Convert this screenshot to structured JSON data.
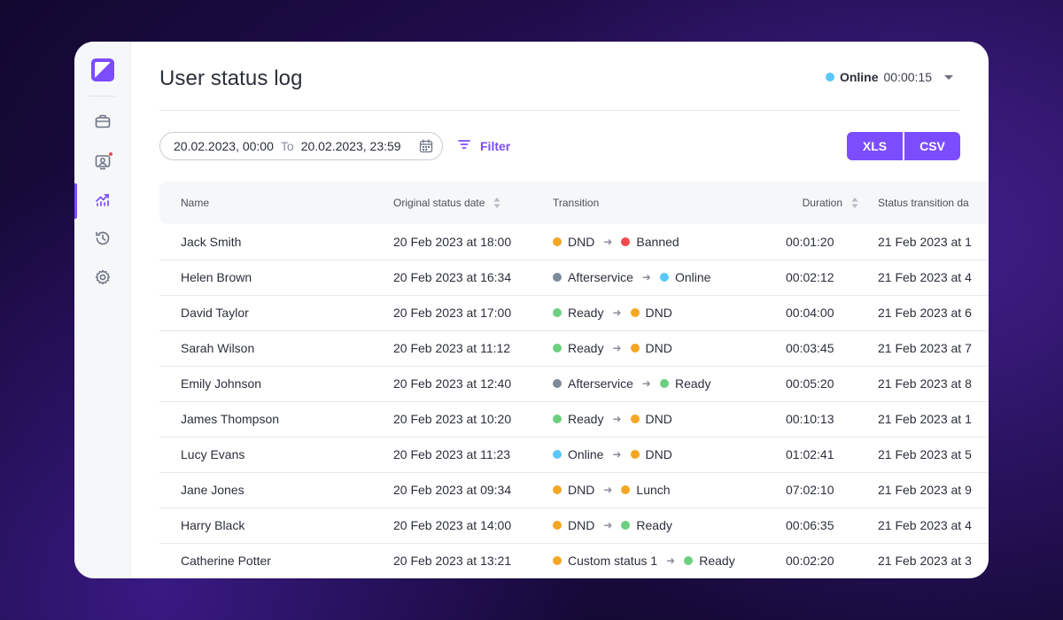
{
  "header": {
    "title": "User status log",
    "status_label": "Online",
    "status_time": "00:00:15",
    "status_color": "#5ac8fa"
  },
  "sidebar": {
    "items": [
      {
        "icon": "briefcase-icon",
        "active": false
      },
      {
        "icon": "user-monitor-icon",
        "active": false,
        "badge": true
      },
      {
        "icon": "analytics-icon",
        "active": true
      },
      {
        "icon": "history-icon",
        "active": false
      },
      {
        "icon": "gear-icon",
        "active": false
      }
    ]
  },
  "toolbar": {
    "date_from": "20.02.2023, 00:00",
    "to_label": "To",
    "date_to": "20.02.2023, 23:59",
    "filter_label": "Filter",
    "xls_label": "XLS",
    "csv_label": "CSV",
    "accent": "#7c4dff"
  },
  "table": {
    "columns": {
      "name": "Name",
      "original_date": "Original status date",
      "transition": "Transition",
      "duration": "Duration",
      "transition_date": "Status transition da"
    },
    "status_colors": {
      "DND": "#f5a623",
      "Banned": "#f04b4b",
      "Afterservice": "#7d8a99",
      "Online": "#5ac8fa",
      "Ready": "#6ccf7f",
      "Lunch": "#f5a623",
      "Custom status 1": "#f5a623"
    },
    "rows": [
      {
        "name": "Jack Smith",
        "date": "20 Feb 2023 at 18:00",
        "from": "DND",
        "to": "Banned",
        "duration": "00:01:20",
        "tdate": "21 Feb 2023 at 1"
      },
      {
        "name": "Helen Brown",
        "date": "20 Feb 2023 at 16:34",
        "from": "Afterservice",
        "to": "Online",
        "duration": "00:02:12",
        "tdate": "21 Feb 2023 at 4"
      },
      {
        "name": "David Taylor",
        "date": "20 Feb 2023 at 17:00",
        "from": "Ready",
        "to": "DND",
        "duration": "00:04:00",
        "tdate": "21 Feb 2023 at 6"
      },
      {
        "name": "Sarah Wilson",
        "date": "20 Feb 2023 at 11:12",
        "from": "Ready",
        "to": "DND",
        "duration": "00:03:45",
        "tdate": "21 Feb 2023 at 7"
      },
      {
        "name": "Emily Johnson",
        "date": "20 Feb 2023 at 12:40",
        "from": "Afterservice",
        "to": "Ready",
        "duration": "00:05:20",
        "tdate": "21 Feb 2023 at 8"
      },
      {
        "name": "James Thompson",
        "date": "20 Feb 2023 at 10:20",
        "from": "Ready",
        "to": "DND",
        "duration": "00:10:13",
        "tdate": "21 Feb 2023 at 1"
      },
      {
        "name": "Lucy Evans",
        "date": "20 Feb 2023 at 11:23",
        "from": "Online",
        "to": "DND",
        "duration": "01:02:41",
        "tdate": "21 Feb 2023 at 5"
      },
      {
        "name": "Jane Jones",
        "date": "20 Feb 2023 at 09:34",
        "from": "DND",
        "to": "Lunch",
        "duration": "07:02:10",
        "tdate": "21 Feb 2023 at 9"
      },
      {
        "name": "Harry Black",
        "date": "20 Feb 2023 at 14:00",
        "from": "DND",
        "to": "Ready",
        "duration": "00:06:35",
        "tdate": "21 Feb 2023 at 4"
      },
      {
        "name": "Catherine Potter",
        "date": "20 Feb 2023 at  13:21",
        "from": "Custom status 1",
        "to": "Ready",
        "duration": "00:02:20",
        "tdate": "21 Feb 2023 at 3"
      }
    ]
  }
}
